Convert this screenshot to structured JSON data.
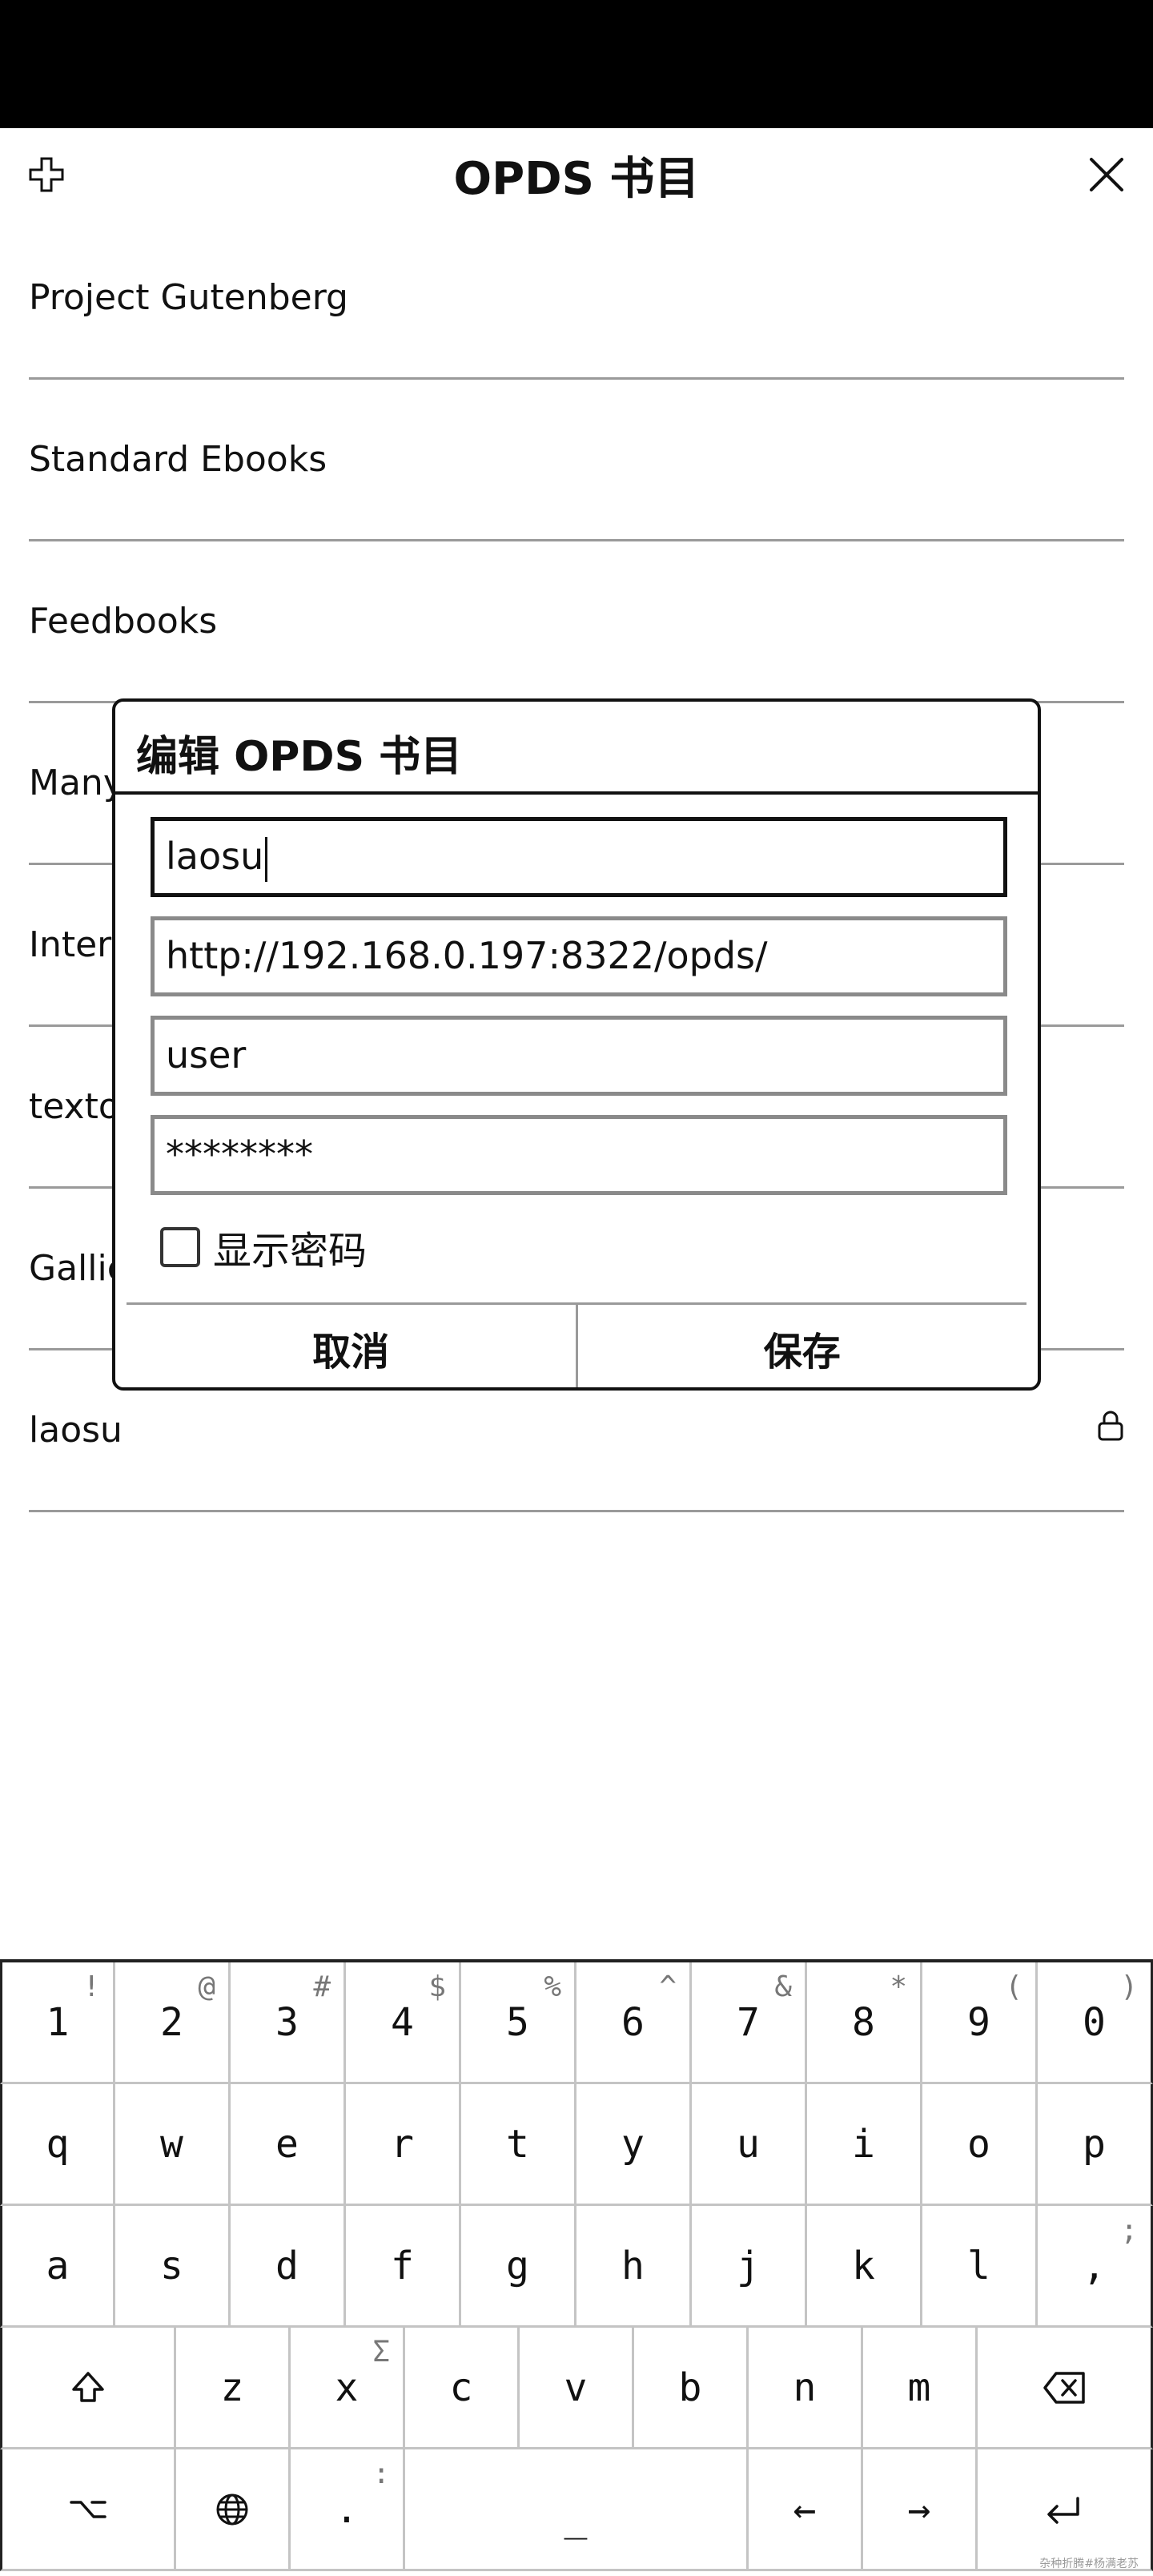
{
  "header": {
    "title": "OPDS 书目"
  },
  "catalogs": [
    {
      "label": "Project Gutenberg"
    },
    {
      "label": "Standard Ebooks"
    },
    {
      "label": "Feedbooks"
    },
    {
      "label": "Many"
    },
    {
      "label": "Inter"
    },
    {
      "label": "texto"
    },
    {
      "label": "Gallic"
    },
    {
      "label": "laosu",
      "icon": "lock-icon"
    }
  ],
  "dialog": {
    "title": "编辑 OPDS 书目",
    "name_value": "laosu",
    "url_value": "http://192.168.0.197:8322/opds/",
    "username_value": "user",
    "password_value": "********",
    "show_password_label": "显示密码",
    "show_password_checked": false,
    "cancel_label": "取消",
    "save_label": "保存"
  },
  "keyboard": {
    "row1": [
      {
        "k": "1",
        "alt": "!"
      },
      {
        "k": "2",
        "alt": "@"
      },
      {
        "k": "3",
        "alt": "#"
      },
      {
        "k": "4",
        "alt": "$"
      },
      {
        "k": "5",
        "alt": "%"
      },
      {
        "k": "6",
        "alt": "^"
      },
      {
        "k": "7",
        "alt": "&"
      },
      {
        "k": "8",
        "alt": "*"
      },
      {
        "k": "9",
        "alt": "("
      },
      {
        "k": "0",
        "alt": ")"
      }
    ],
    "row2": [
      "q",
      "w",
      "e",
      "r",
      "t",
      "y",
      "u",
      "i",
      "o",
      "p"
    ],
    "row3": [
      {
        "k": "a"
      },
      {
        "k": "s"
      },
      {
        "k": "d"
      },
      {
        "k": "f"
      },
      {
        "k": "g"
      },
      {
        "k": "h"
      },
      {
        "k": "j"
      },
      {
        "k": "k"
      },
      {
        "k": "l"
      },
      {
        "k": ",",
        "alt": ";"
      }
    ],
    "row4": {
      "letters": [
        {
          "k": "z"
        },
        {
          "k": "x",
          "alt": "Σ"
        },
        {
          "k": "c"
        },
        {
          "k": "v"
        },
        {
          "k": "b"
        },
        {
          "k": "n"
        },
        {
          "k": "m"
        }
      ]
    },
    "row5": {
      "dot": ".",
      "dot_alt": ":",
      "space": "_",
      "left": "←",
      "right": "→"
    },
    "icons": {
      "shift": "shift-icon",
      "backspace": "backspace-icon",
      "alt": "option-icon",
      "globe": "globe-icon",
      "enter": "enter-icon"
    }
  },
  "watermark": "杂种折腾#杨满老苏"
}
